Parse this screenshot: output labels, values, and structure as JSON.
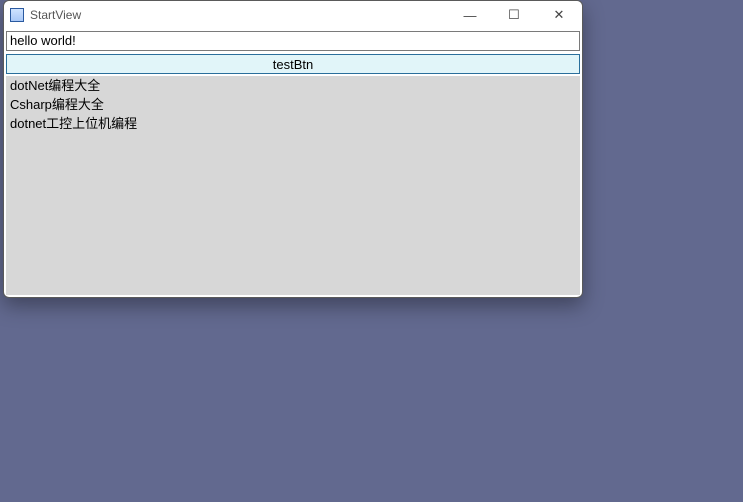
{
  "window": {
    "title": "StartView"
  },
  "textbox": {
    "value": "hello world!"
  },
  "button": {
    "label": "testBtn"
  },
  "list": {
    "items": [
      "dotNet编程大全",
      "Csharp编程大全",
      "dotnet工控上位机编程"
    ]
  },
  "winControls": {
    "minimize": "—",
    "maximize": "☐",
    "close": "✕"
  }
}
